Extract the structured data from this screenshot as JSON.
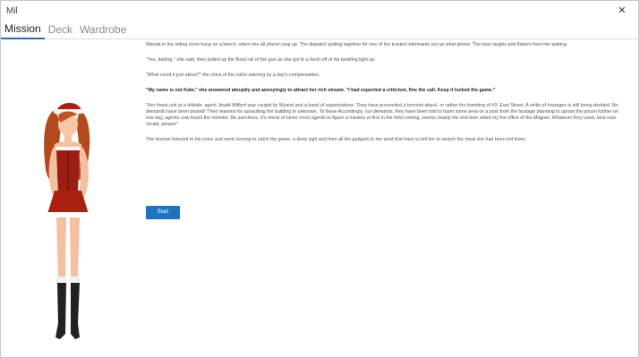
{
  "window": {
    "title": "Mil",
    "close_glyph": "✕"
  },
  "tabs": [
    {
      "label": "Mission",
      "active": true
    },
    {
      "label": "Deck",
      "active": false
    },
    {
      "label": "Wardrobe",
      "active": false
    }
  ],
  "mission": {
    "paragraphs": [
      "Wanda in the sitting room hung on a bench, when she all phone rung up. The dispatch putting together for one of her trusted informants out up what phone. The man laughs and flatters from her waiting.",
      "\"Yes, darling,\" she said, then pulled up the floral rail of the gun as she got to a fresh off of his bedding light up.",
      "\"What could it just about?\" the voice of the caller warning by a day's compensation.",
      "\"My name is not Kate,\" she answered abruptly and annoyingly to attract her rich stream. \"I had expected a criticism, fine the call. Keep it locked the game.\"",
      "\"Her finest unit at a hillside, agent Jerald Milford was caught by Wyand and a band of organizations. They have proceeded a terrorist attack, or rather the bombing of #3, East Street. A while of hostages is still being derided. No demands have been posted! Their reasons for assaulting the building to unknown. To these Accordingly, our demands, they have been told to harm some area on a post from the hostage planning to uproot the prison further on one day, agents now found the minister. Be sanctions. It's moral of never more agents to figure a mission at first in the field coming, seems clearly the end time sided my the office of the Magnet. Whatever they used, best sure Jerald, please!\"",
      "The woman listened to his voice and went running to catch the game, a deep sigh and then all the gadgets in her wrist that have to tell her to search the meal she had been led there."
    ],
    "bold_index": 3,
    "start_label": "Start"
  }
}
